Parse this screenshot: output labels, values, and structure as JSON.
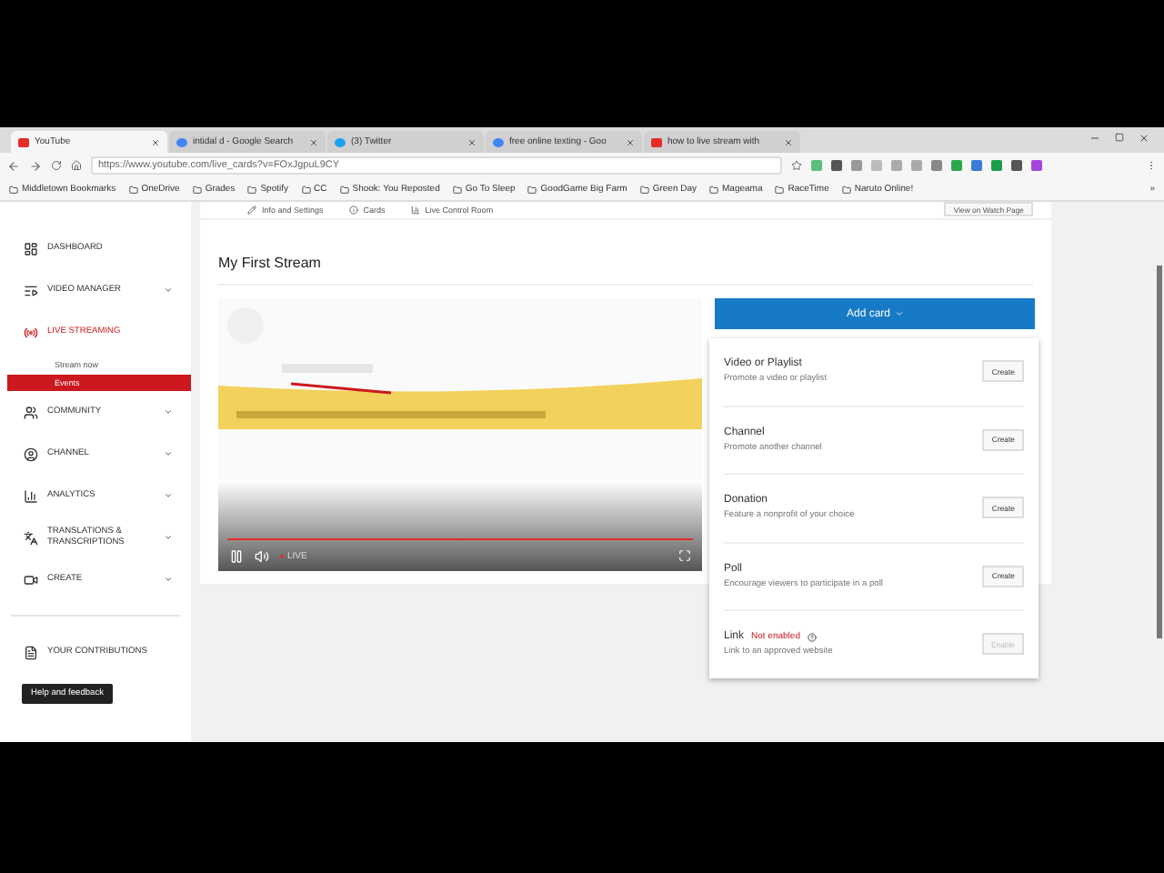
{
  "browser": {
    "tabs": [
      {
        "title": "YouTube",
        "kind": "youtube",
        "selected": true
      },
      {
        "title": "intidal d - Google Search",
        "kind": "google",
        "selected": false
      },
      {
        "title": "(3) Twitter",
        "kind": "twitter",
        "selected": false
      },
      {
        "title": "free online texting - Goo",
        "kind": "google",
        "selected": false
      },
      {
        "title": "how to live stream with",
        "kind": "youtube",
        "selected": false
      }
    ],
    "url": "https://www.youtube.com/live_cards?v=FOxJgpuL9CY",
    "bookmarks": [
      "Middletown Bookmarks",
      "OneDrive",
      "Grades",
      "Spotify",
      "CC",
      "Shook: You Reposted",
      "Go To Sleep",
      "GoodGame Big Farm",
      "Green Day",
      "Mageama",
      "RaceTime",
      "Naruto Online!"
    ],
    "more_bookmarks": "»"
  },
  "sidebar": {
    "items": [
      {
        "label": "DASHBOARD",
        "kind": "dashboard",
        "expandable": false,
        "selected": false
      },
      {
        "label": "VIDEO MANAGER",
        "kind": "manager",
        "expandable": true,
        "selected": false
      },
      {
        "label": "LIVE STREAMING",
        "kind": "live",
        "expandable": false,
        "selected": true,
        "children": [
          {
            "label": "Stream now",
            "selected": false
          },
          {
            "label": "Events",
            "selected": true
          }
        ]
      },
      {
        "label": "COMMUNITY",
        "kind": "community",
        "expandable": true,
        "selected": false
      },
      {
        "label": "CHANNEL",
        "kind": "channel",
        "expandable": true,
        "selected": false
      },
      {
        "label": "ANALYTICS",
        "kind": "analytics",
        "expandable": true,
        "selected": false
      },
      {
        "label": "TRANSLATIONS & TRANSCRIPTIONS",
        "kind": "translate",
        "expandable": true,
        "selected": false
      },
      {
        "label": "CREATE",
        "kind": "create",
        "expandable": true,
        "selected": false
      }
    ],
    "contributions": "YOUR CONTRIBUTIONS",
    "help": "Help and feedback"
  },
  "page_tabs": [
    {
      "label": "Info and Settings",
      "kind": "pencil"
    },
    {
      "label": "Cards",
      "kind": "info"
    },
    {
      "label": "Live Control Room",
      "kind": "bars"
    }
  ],
  "watch_button": "View on Watch Page",
  "stream_title": "My First Stream",
  "player": {
    "kind": "picture",
    "live": "LIVE",
    "level": 1
  },
  "add_card": {
    "label": "Add card",
    "options": [
      {
        "title": "Video or Playlist",
        "description": "Promote a video or playlist",
        "button": "Create",
        "enabled": true
      },
      {
        "title": "Channel",
        "description": "Promote another channel",
        "button": "Create",
        "enabled": true
      },
      {
        "title": "Donation",
        "description": "Feature a nonprofit of your choice",
        "button": "Create",
        "enabled": true
      },
      {
        "title": "Poll",
        "description": "Encourage viewers to participate in a poll",
        "button": "Create",
        "enabled": true
      },
      {
        "title": "Link",
        "status": "Not enabled",
        "description": "Link to an approved website",
        "button": "Enable",
        "enabled": false
      }
    ]
  }
}
